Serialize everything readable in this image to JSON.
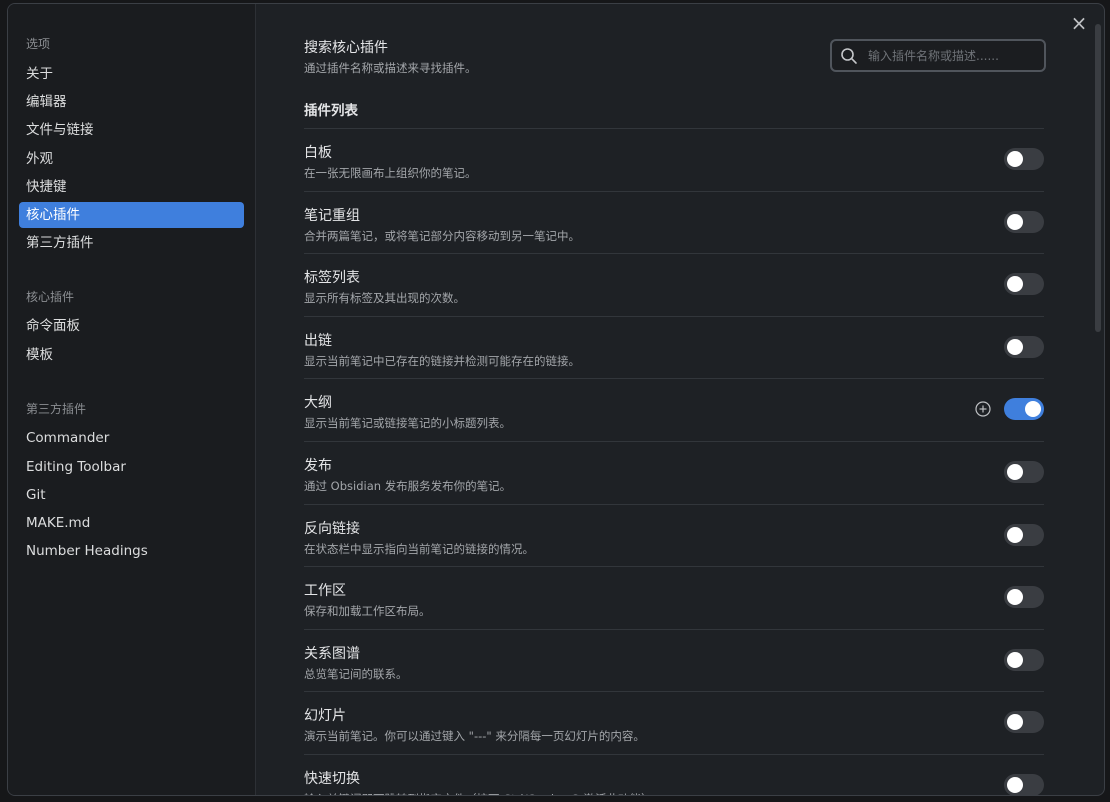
{
  "sidebar": {
    "sections": [
      {
        "heading": "选项",
        "items": [
          "关于",
          "编辑器",
          "文件与链接",
          "外观",
          "快捷键",
          "核心插件",
          "第三方插件"
        ]
      },
      {
        "heading": "核心插件",
        "items": [
          "命令面板",
          "模板"
        ]
      },
      {
        "heading": "第三方插件",
        "items": [
          "Commander",
          "Editing Toolbar",
          "Git",
          "MAKE.md",
          "Number Headings"
        ]
      }
    ],
    "active_item": "核心插件"
  },
  "close_icon": "×",
  "search": {
    "title": "搜索核心插件",
    "description": "通过插件名称或描述来寻找插件。",
    "placeholder": "输入插件名称或描述......",
    "icon": "search-icon"
  },
  "list_heading": "插件列表",
  "plugins": [
    {
      "name": "白板",
      "description": "在一张无限画布上组织你的笔记。",
      "enabled": false
    },
    {
      "name": "笔记重组",
      "description": "合并两篇笔记，或将笔记部分内容移动到另一笔记中。",
      "enabled": false
    },
    {
      "name": "标签列表",
      "description": "显示所有标签及其出现的次数。",
      "enabled": false
    },
    {
      "name": "出链",
      "description": "显示当前笔记中已存在的链接并检测可能存在的链接。",
      "enabled": false
    },
    {
      "name": "大纲",
      "description": "显示当前笔记或链接笔记的小标题列表。",
      "enabled": true,
      "has_options": true
    },
    {
      "name": "发布",
      "description": "通过 Obsidian 发布服务发布你的笔记。",
      "enabled": false
    },
    {
      "name": "反向链接",
      "description": "在状态栏中显示指向当前笔记的链接的情况。",
      "enabled": false
    },
    {
      "name": "工作区",
      "description": "保存和加载工作区布局。",
      "enabled": false
    },
    {
      "name": "关系图谱",
      "description": "总览笔记间的联系。",
      "enabled": false
    },
    {
      "name": "幻灯片",
      "description": "演示当前笔记。你可以通过键入 \"---\" 来分隔每一页幻灯片的内容。",
      "enabled": false
    },
    {
      "name": "快速切换",
      "description": "输入关键词即可跳转到指定文件（按下 Ctrl/Cmd + O 激活此功能）",
      "enabled": false
    }
  ],
  "colors": {
    "accent": "#3f7fdd",
    "background": "#1e2125",
    "sidebar": "#1a1c1f",
    "toggle_off": "#3a3d42"
  }
}
